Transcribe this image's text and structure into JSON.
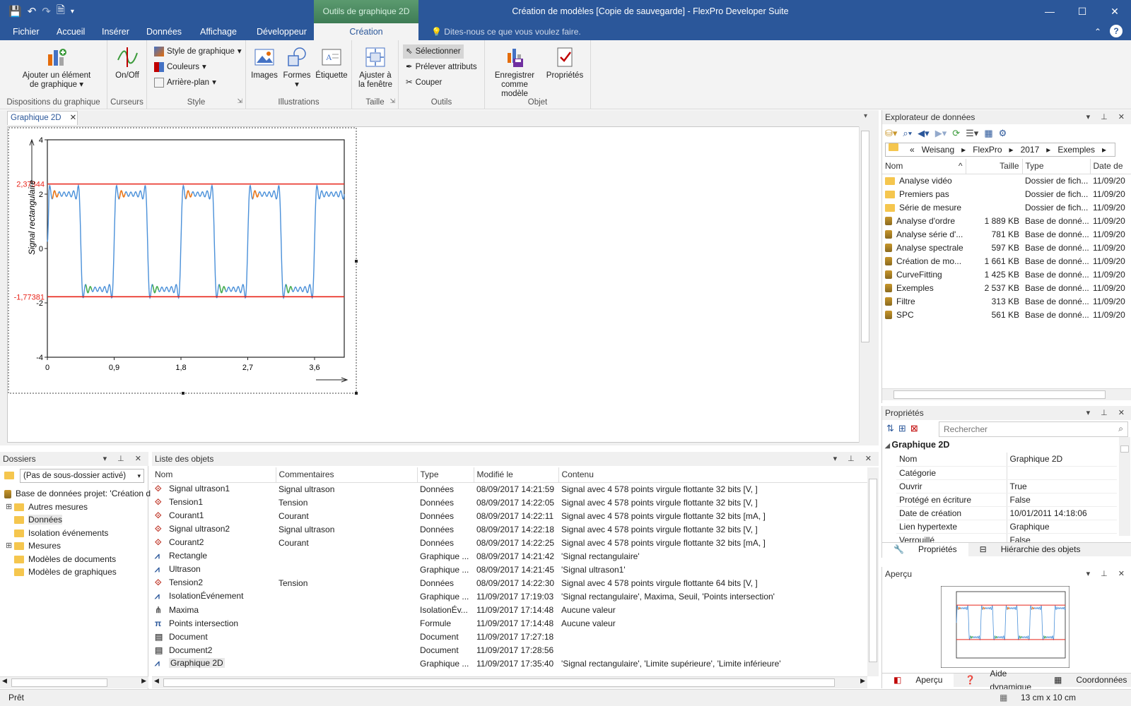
{
  "window": {
    "title": "Création de modèles [Copie de sauvegarde] - FlexPro Developer Suite",
    "context_tab": "Outils de graphique 2D",
    "controls": [
      "—",
      "☐",
      "✕"
    ]
  },
  "menu": {
    "items": [
      "Fichier",
      "Accueil",
      "Insérer",
      "Données",
      "Affichage",
      "Développeur",
      "Création"
    ],
    "tell_me": "Dites-nous ce que vous voulez faire."
  },
  "ribbon": {
    "groups": {
      "dispositions": {
        "label": "Dispositions du graphique",
        "add_element": "Ajouter un élément",
        "add_element2": "de graphique"
      },
      "curseurs": {
        "label": "Curseurs",
        "onoff": "On/Off"
      },
      "style": {
        "label": "Style",
        "style_graph": "Style de graphique",
        "couleurs": "Couleurs",
        "arriere_plan": "Arrière-plan"
      },
      "illustrations": {
        "label": "Illustrations",
        "images": "Images",
        "formes": "Formes",
        "etiquette": "Étiquette"
      },
      "taille": {
        "label": "Taille",
        "ajuster": "Ajuster à",
        "ajuster2": "la fenêtre"
      },
      "outils": {
        "label": "Outils",
        "selectionner": "Sélectionner",
        "prelever": "Prélever attributs",
        "couper": "Couper"
      },
      "objet": {
        "label": "Objet",
        "enregistrer": "Enregistrer",
        "enregistrer2": "comme modèle",
        "proprietes": "Propriétés"
      }
    }
  },
  "document": {
    "tab_label": "Graphique 2D"
  },
  "chart_data": {
    "type": "line",
    "ylabel": "Signal rectangulaire",
    "x_ticks": [
      "0",
      "0,9",
      "1,8",
      "2,7",
      "3,6"
    ],
    "y_ticks": [
      "4",
      "2",
      "0",
      "-2",
      "-4"
    ],
    "xlim": [
      0,
      4.0
    ],
    "ylim": [
      -4,
      4
    ],
    "hlines": [
      {
        "value": 2.37344,
        "label": "2,37344",
        "color": "#e8241a"
      },
      {
        "value": -1.77381,
        "label": "-1,77381",
        "color": "#e8241a"
      }
    ],
    "series": [
      {
        "type": "square-wave",
        "color": "#4a90d9",
        "period": 0.9,
        "high": 2.0,
        "low": -1.5,
        "start": 0.0
      }
    ],
    "maxima_color": "#f07a1a",
    "minima_color": "#4caf50"
  },
  "explorer": {
    "title": "Explorateur de données",
    "breadcrumb": [
      "«",
      "Weisang",
      "FlexPro",
      "2017",
      "Exemples"
    ],
    "columns": [
      "Nom",
      "Taille",
      "Type",
      "Date de"
    ],
    "rows": [
      {
        "name": "Analyse vidéo",
        "size": "",
        "type": "Dossier de fich...",
        "date": "11/09/20",
        "kind": "folder"
      },
      {
        "name": "Premiers pas",
        "size": "",
        "type": "Dossier de fich...",
        "date": "11/09/20",
        "kind": "folder"
      },
      {
        "name": "Série de mesure",
        "size": "",
        "type": "Dossier de fich...",
        "date": "11/09/20",
        "kind": "folder"
      },
      {
        "name": "Analyse d'ordre",
        "size": "1 889 KB",
        "type": "Base de donné...",
        "date": "11/09/20",
        "kind": "db"
      },
      {
        "name": "Analyse série d'...",
        "size": "781 KB",
        "type": "Base de donné...",
        "date": "11/09/20",
        "kind": "db"
      },
      {
        "name": "Analyse spectrale",
        "size": "597 KB",
        "type": "Base de donné...",
        "date": "11/09/20",
        "kind": "db"
      },
      {
        "name": "Création de mo...",
        "size": "1 661 KB",
        "type": "Base de donné...",
        "date": "11/09/20",
        "kind": "db"
      },
      {
        "name": "CurveFitting",
        "size": "1 425 KB",
        "type": "Base de donné...",
        "date": "11/09/20",
        "kind": "db"
      },
      {
        "name": "Exemples",
        "size": "2 537 KB",
        "type": "Base de donné...",
        "date": "11/09/20",
        "kind": "db"
      },
      {
        "name": "Filtre",
        "size": "313 KB",
        "type": "Base de donné...",
        "date": "11/09/20",
        "kind": "db"
      },
      {
        "name": "SPC",
        "size": "561 KB",
        "type": "Base de donné...",
        "date": "11/09/20",
        "kind": "db"
      }
    ]
  },
  "properties": {
    "title": "Propriétés",
    "search_placeholder": "Rechercher",
    "object": "Graphique 2D",
    "rows": [
      {
        "k": "Nom",
        "v": "Graphique 2D"
      },
      {
        "k": "Catégorie",
        "v": ""
      },
      {
        "k": "Ouvrir",
        "v": "True"
      },
      {
        "k": "Protégé en écriture",
        "v": "False"
      },
      {
        "k": "Date de création",
        "v": "10/01/2011 14:18:06"
      },
      {
        "k": "Lien hypertexte",
        "v": "Graphique"
      },
      {
        "k": "Verrouillé",
        "v": "False"
      }
    ],
    "tabs": [
      "Propriétés",
      "Hiérarchie des objets"
    ]
  },
  "preview": {
    "title": "Aperçu",
    "tabs": [
      "Aperçu",
      "Aide dynamique",
      "Coordonnées"
    ]
  },
  "folders": {
    "title": "Dossiers",
    "dropdown": "(Pas de sous-dossier activé)",
    "items": [
      {
        "label": "Base de données projet: 'Création d",
        "level": 0,
        "expand": "",
        "kind": "db"
      },
      {
        "label": "Autres mesures",
        "level": 1,
        "expand": "+",
        "kind": "folder"
      },
      {
        "label": "Données",
        "level": 1,
        "expand": "",
        "kind": "folder"
      },
      {
        "label": "Isolation événements",
        "level": 1,
        "expand": "",
        "kind": "folder"
      },
      {
        "label": "Mesures",
        "level": 1,
        "expand": "+",
        "kind": "folder"
      },
      {
        "label": "Modèles de documents",
        "level": 1,
        "expand": "",
        "kind": "folder"
      },
      {
        "label": "Modèles de graphiques",
        "level": 1,
        "expand": "",
        "kind": "folder"
      }
    ]
  },
  "objlist": {
    "title": "Liste des objets",
    "columns": [
      "Nom",
      "Commentaires",
      "Type",
      "Modifié le",
      "Contenu"
    ],
    "rows": [
      {
        "icon": "data",
        "name": "Signal ultrason1",
        "comment": "Signal ultrason",
        "type": "Données",
        "date": "08/09/2017 14:21:59",
        "content": "Signal avec 4 578 points virgule flottante 32 bits [V, ]"
      },
      {
        "icon": "data",
        "name": "Tension1",
        "comment": "Tension",
        "type": "Données",
        "date": "08/09/2017 14:22:05",
        "content": "Signal avec 4 578 points virgule flottante 32 bits [V, ]"
      },
      {
        "icon": "data",
        "name": "Courant1",
        "comment": "Courant",
        "type": "Données",
        "date": "08/09/2017 14:22:11",
        "content": "Signal avec 4 578 points virgule flottante 32 bits [mA, ]"
      },
      {
        "icon": "data",
        "name": "Signal ultrason2",
        "comment": "Signal ultrason",
        "type": "Données",
        "date": "08/09/2017 14:22:18",
        "content": "Signal avec 4 578 points virgule flottante 32 bits [V, ]"
      },
      {
        "icon": "data",
        "name": "Courant2",
        "comment": "Courant",
        "type": "Données",
        "date": "08/09/2017 14:22:25",
        "content": "Signal avec 4 578 points virgule flottante 32 bits [mA, ]"
      },
      {
        "icon": "graph",
        "name": "Rectangle",
        "comment": "",
        "type": "Graphique ...",
        "date": "08/09/2017 14:21:42",
        "content": "'Signal rectangulaire'"
      },
      {
        "icon": "graph",
        "name": "Ultrason",
        "comment": "",
        "type": "Graphique ...",
        "date": "08/09/2017 14:21:45",
        "content": "'Signal ultrason1'"
      },
      {
        "icon": "data",
        "name": "Tension2",
        "comment": "Tension",
        "type": "Données",
        "date": "08/09/2017 14:22:30",
        "content": "Signal avec 4 578 points virgule flottante 64 bits [V, ]"
      },
      {
        "icon": "graph",
        "name": "IsolationÉvénement",
        "comment": "",
        "type": "Graphique ...",
        "date": "11/09/2017 17:19:03",
        "content": "'Signal rectangulaire', Maxima, Seuil, 'Points intersection'"
      },
      {
        "icon": "iso",
        "name": "Maxima",
        "comment": "",
        "type": "IsolationÉv...",
        "date": "11/09/2017 17:14:48",
        "content": "Aucune valeur"
      },
      {
        "icon": "pi",
        "name": "Points intersection",
        "comment": "",
        "type": "Formule",
        "date": "11/09/2017 17:14:48",
        "content": "Aucune valeur"
      },
      {
        "icon": "doc",
        "name": "Document",
        "comment": "",
        "type": "Document",
        "date": "11/09/2017 17:27:18",
        "content": ""
      },
      {
        "icon": "doc",
        "name": "Document2",
        "comment": "",
        "type": "Document",
        "date": "11/09/2017 17:28:56",
        "content": ""
      },
      {
        "icon": "graph",
        "name": "Graphique 2D",
        "comment": "",
        "type": "Graphique ...",
        "date": "11/09/2017 17:35:40",
        "content": "'Signal rectangulaire', 'Limite supérieure', 'Limite inférieure'"
      }
    ]
  },
  "status": {
    "left": "Prêt",
    "right": "13 cm x 10 cm"
  }
}
